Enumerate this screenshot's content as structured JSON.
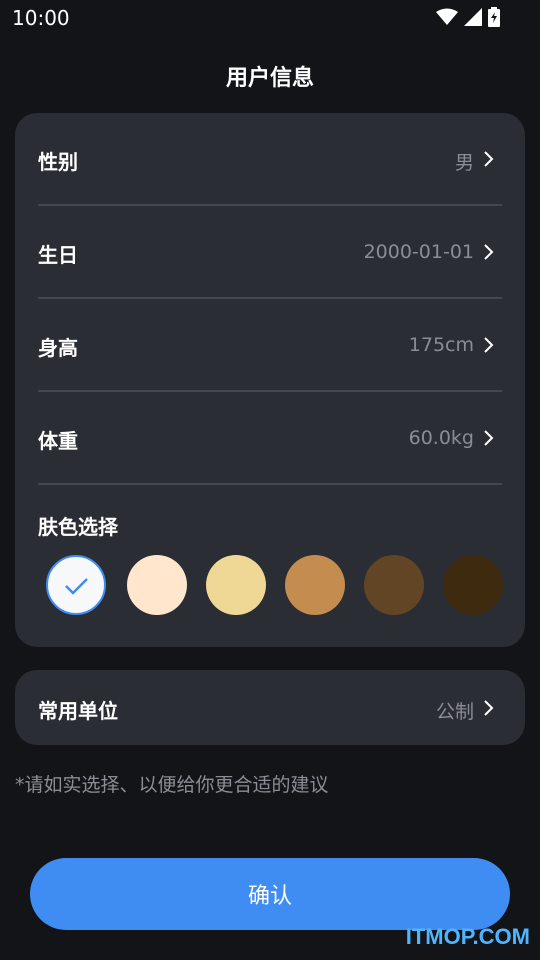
{
  "status_bar": {
    "time": "10:00"
  },
  "title": "用户信息",
  "profile": {
    "rows": [
      {
        "label": "性别",
        "value": "男"
      },
      {
        "label": "生日",
        "value": "2000-01-01"
      },
      {
        "label": "身高",
        "value": "175cm"
      },
      {
        "label": "体重",
        "value": "60.0kg"
      }
    ],
    "skin_title": "肤色选择",
    "skin_colors": [
      "#f7f8fa",
      "#ffe6cc",
      "#efd795",
      "#c48c4e",
      "#624525",
      "#3e2a0e"
    ],
    "selected_skin_index": 0
  },
  "unit": {
    "label": "常用单位",
    "value": "公制"
  },
  "hint": "*请如实选择、以便给你更合适的建议",
  "confirm_label": "确认",
  "watermark": "ITMOP.COM",
  "colors": {
    "accent": "#3f8df3",
    "card": "#2a2d33",
    "background": "#121418"
  }
}
